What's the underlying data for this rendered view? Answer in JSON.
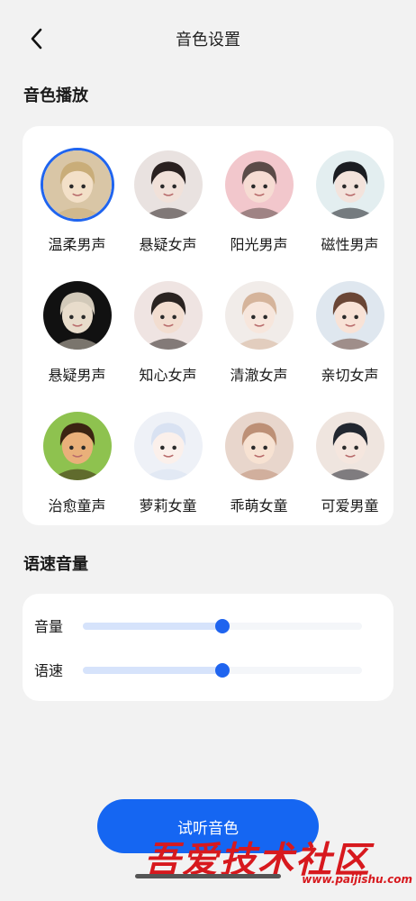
{
  "header": {
    "title": "音色设置"
  },
  "sections": {
    "voice_play": "音色播放",
    "speed_volume": "语速音量"
  },
  "voices": [
    {
      "label": "温柔男声",
      "selected": true,
      "bg": "#d9c6a6",
      "hair": "#c9ad79",
      "skin": "#f3e0c8"
    },
    {
      "label": "悬疑女声",
      "selected": false,
      "bg": "#e9e2e0",
      "hair": "#2a2120",
      "skin": "#f1e1d9"
    },
    {
      "label": "阳光男声",
      "selected": false,
      "bg": "#f2c7cc",
      "hair": "#5b4b48",
      "skin": "#f6dcd3"
    },
    {
      "label": "磁性男声",
      "selected": false,
      "bg": "#e3eef0",
      "hair": "#1b1d22",
      "skin": "#f3e3dc"
    },
    {
      "label": "悬疑男声",
      "selected": false,
      "bg": "#111111",
      "hair": "#d2c9b9",
      "skin": "#e8dccb"
    },
    {
      "label": "知心女声",
      "selected": false,
      "bg": "#efe4e2",
      "hair": "#2a2321",
      "skin": "#f2ddd0"
    },
    {
      "label": "清澈女声",
      "selected": false,
      "bg": "#f1ece9",
      "hair": "#d5b49b",
      "skin": "#f7e6dc"
    },
    {
      "label": "亲切女声",
      "selected": false,
      "bg": "#dfe7ef",
      "hair": "#6a4636",
      "skin": "#f8e2d6"
    },
    {
      "label": "治愈童声",
      "selected": false,
      "bg": "#8ec24f",
      "hair": "#3b2412",
      "skin": "#e9b07a"
    },
    {
      "label": "萝莉女童",
      "selected": false,
      "bg": "#eef1f7",
      "hair": "#d9e2f2",
      "skin": "#fbf0eb"
    },
    {
      "label": "乖萌女童",
      "selected": false,
      "bg": "#e8d6cc",
      "hair": "#bd9076",
      "skin": "#f7e2d2"
    },
    {
      "label": "可爱男童",
      "selected": false,
      "bg": "#efe5df",
      "hair": "#222730",
      "skin": "#f5e6de"
    }
  ],
  "sliders": {
    "volume": {
      "label": "音量",
      "value": 0.5
    },
    "speed": {
      "label": "语速",
      "value": 0.5
    }
  },
  "play_button": "试听音色",
  "watermark": {
    "text": "吾爱技术社区",
    "url": "www.paijishu.com"
  },
  "colors": {
    "accent": "#1566f2",
    "card": "#ffffff",
    "page_bg": "#f2f2f2"
  }
}
